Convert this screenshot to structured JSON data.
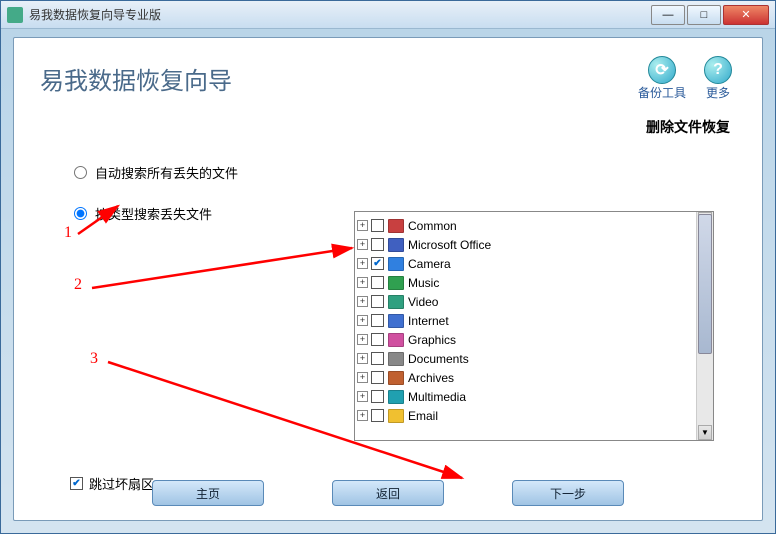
{
  "window": {
    "title": "易我数据恢复向导专业版"
  },
  "header": {
    "app_title": "易我数据恢复向导",
    "backup_tool": "备份工具",
    "more": "更多",
    "more_symbol": "?"
  },
  "subtitle": "删除文件恢复",
  "options": {
    "auto_search": "自动搜索所有丢失的文件",
    "by_type": "按类型搜索丢失文件"
  },
  "tree": {
    "items": [
      {
        "label": "Common",
        "checked": false,
        "icon_color": "#c84040"
      },
      {
        "label": "Microsoft Office",
        "checked": false,
        "icon_color": "#4060c0"
      },
      {
        "label": "Camera",
        "checked": true,
        "icon_color": "#3080e0"
      },
      {
        "label": "Music",
        "checked": false,
        "icon_color": "#30a050"
      },
      {
        "label": "Video",
        "checked": false,
        "icon_color": "#30a080"
      },
      {
        "label": "Internet",
        "checked": false,
        "icon_color": "#4070d0"
      },
      {
        "label": "Graphics",
        "checked": false,
        "icon_color": "#d050a0"
      },
      {
        "label": "Documents",
        "checked": false,
        "icon_color": "#888888"
      },
      {
        "label": "Archives",
        "checked": false,
        "icon_color": "#c06030"
      },
      {
        "label": "Multimedia",
        "checked": false,
        "icon_color": "#20a0b0"
      },
      {
        "label": "Email",
        "checked": false,
        "icon_color": "#f0c030"
      }
    ]
  },
  "skip_bad_sectors": {
    "label": "跳过坏扇区",
    "checked": true
  },
  "buttons": {
    "home": "主页",
    "back": "返回",
    "next": "下一步"
  },
  "annotations": {
    "n1": "1",
    "n2": "2",
    "n3": "3"
  }
}
